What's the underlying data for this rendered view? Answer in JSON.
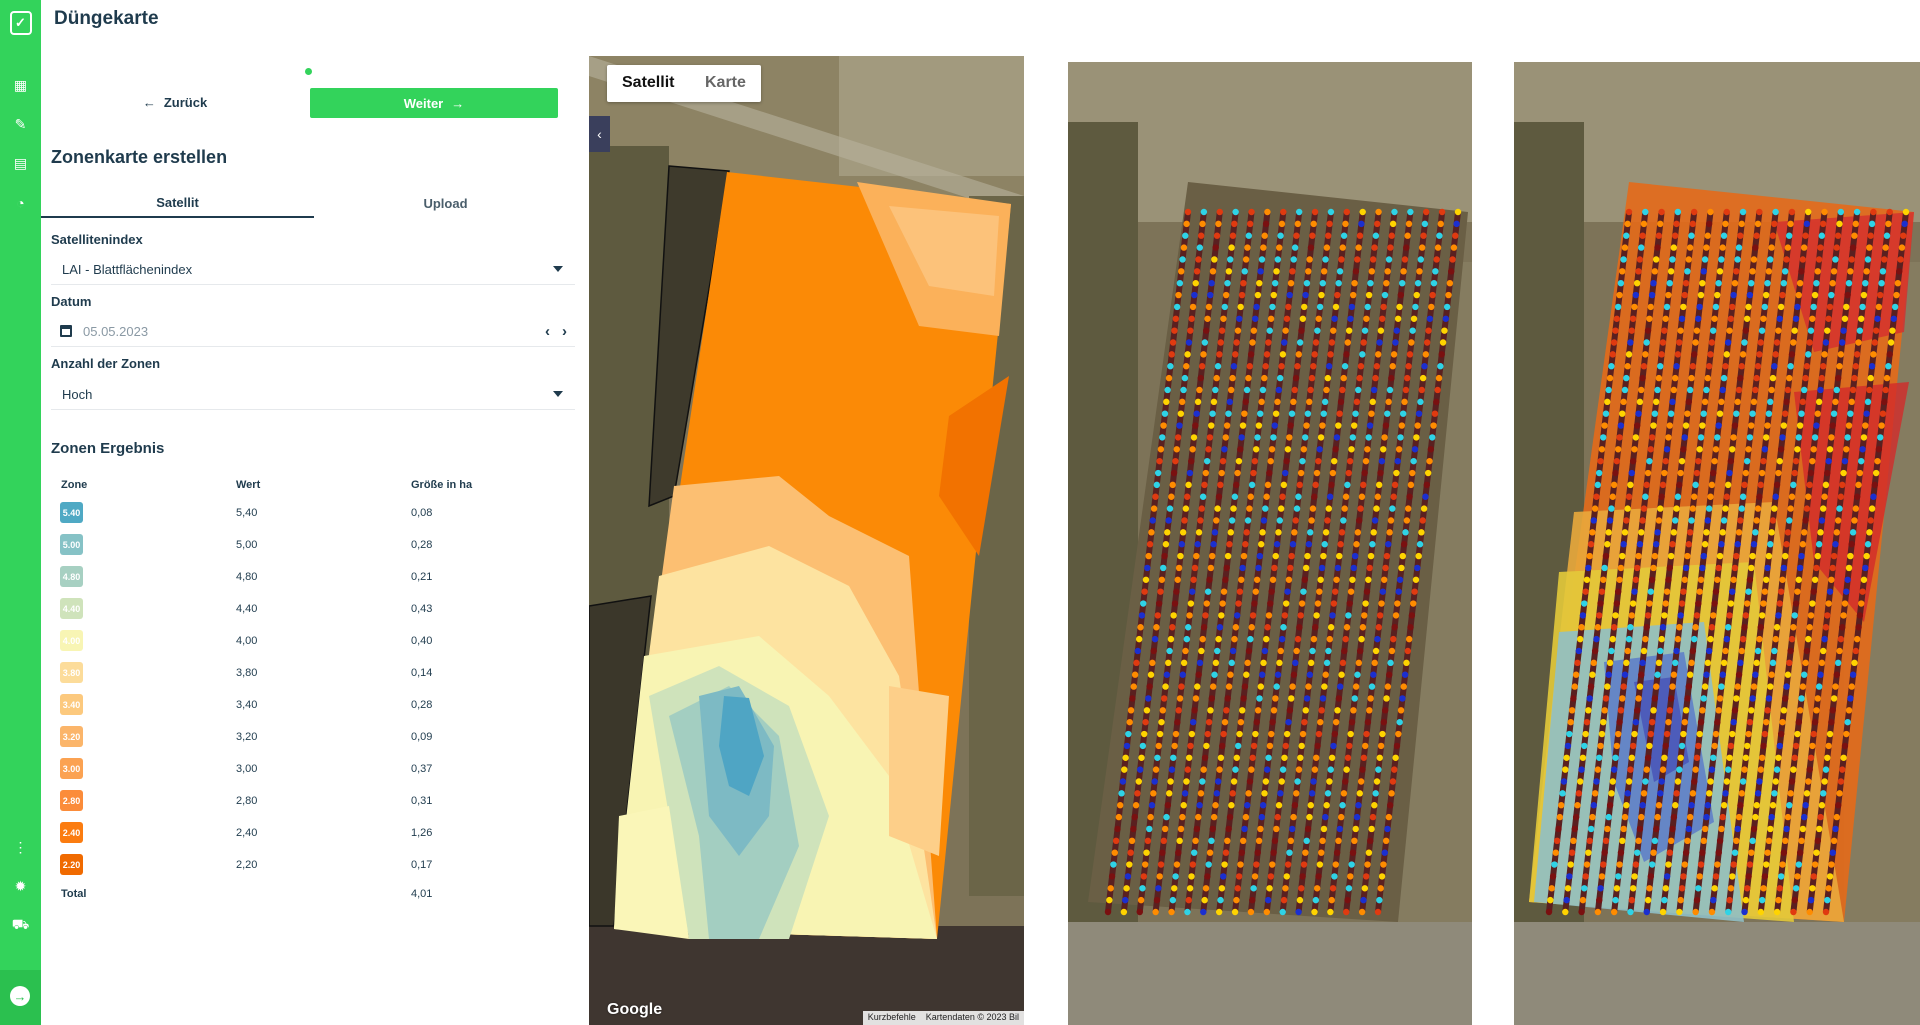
{
  "app": {
    "title": "Düngekarte"
  },
  "nav": {
    "icons": [
      "logo-icon",
      "dashboard-icon",
      "pencil-icon",
      "map-icon",
      "chart-icon",
      "more-icon",
      "settings-icon",
      "cart-icon",
      "logout-icon"
    ]
  },
  "wizard": {
    "back_label": "Zurück",
    "next_label": "Weiter"
  },
  "form": {
    "title": "Zonenkarte erstellen",
    "tabs": [
      {
        "label": "Satellit",
        "active": true
      },
      {
        "label": "Upload",
        "active": false
      }
    ],
    "index_label": "Satellitenindex",
    "index_value": "LAI - Blattflächenindex",
    "date_label": "Datum",
    "date_value": "05.05.2023",
    "zones_label": "Anzahl der Zonen",
    "zones_value": "Hoch"
  },
  "results": {
    "title": "Zonen Ergebnis",
    "headers": {
      "zone": "Zone",
      "value": "Wert",
      "size": "Größe in ha"
    },
    "rows": [
      {
        "badge": "5.40",
        "value": "5,40",
        "size": "0,08",
        "color": "#4fa9c4"
      },
      {
        "badge": "5.00",
        "value": "5,00",
        "size": "0,28",
        "color": "#86c2c6"
      },
      {
        "badge": "4.80",
        "value": "4,80",
        "size": "0,21",
        "color": "#a7d0c2"
      },
      {
        "badge": "4.40",
        "value": "4,40",
        "size": "0,43",
        "color": "#cfe3bb"
      },
      {
        "badge": "4.00",
        "value": "4,00",
        "size": "0,40",
        "color": "#f8f5b4"
      },
      {
        "badge": "3.80",
        "value": "3,80",
        "size": "0,14",
        "color": "#fcdc9a"
      },
      {
        "badge": "3.40",
        "value": "3,40",
        "size": "0,28",
        "color": "#fcc97e"
      },
      {
        "badge": "3.20",
        "value": "3,20",
        "size": "0,09",
        "color": "#fbb56a"
      },
      {
        "badge": "3.00",
        "value": "3,00",
        "size": "0,37",
        "color": "#fba252"
      },
      {
        "badge": "2.80",
        "value": "2,80",
        "size": "0,31",
        "color": "#fb8c3a"
      },
      {
        "badge": "2.40",
        "value": "2,40",
        "size": "1,26",
        "color": "#fb7c10"
      },
      {
        "badge": "2.20",
        "value": "2,20",
        "size": "0,17",
        "color": "#f06a00"
      }
    ],
    "total_label": "Total",
    "total_value": "4,01"
  },
  "map": {
    "toggle": [
      "Satellit",
      "Karte"
    ],
    "google": "Google",
    "attribution_shortcuts": "Kurzbefehle",
    "attribution_data": "Kartendaten © 2023 Bil"
  }
}
